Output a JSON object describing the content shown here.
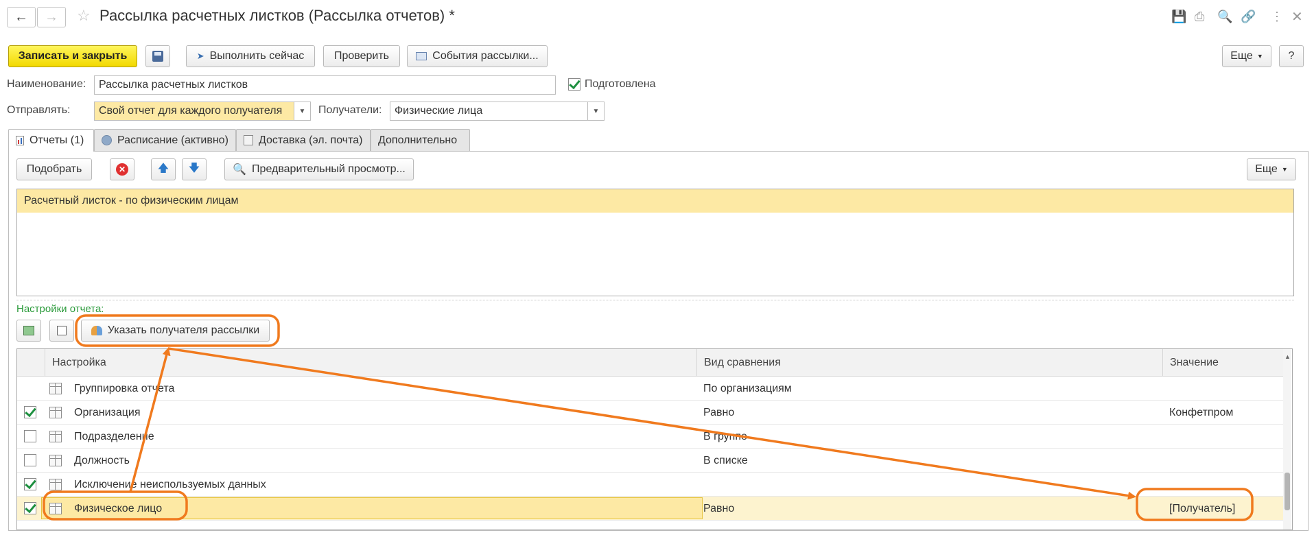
{
  "window": {
    "title": "Рассылка расчетных листков (Рассылка отчетов) *"
  },
  "toolbar": {
    "save_close": "Записать и закрыть",
    "run_now": "Выполнить сейчас",
    "check": "Проверить",
    "events": "События рассылки...",
    "more": "Еще",
    "help": "?"
  },
  "form": {
    "name_label": "Наименование:",
    "name_value": "Рассылка расчетных листков",
    "prepared_label": "Подготовлена",
    "prepared_checked": true,
    "send_label": "Отправлять:",
    "send_value": "Свой отчет для каждого получателя",
    "recipients_label": "Получатели:",
    "recipients_value": "Физические лица"
  },
  "tabs": [
    {
      "label": "Отчеты (1)",
      "active": true
    },
    {
      "label": "Расписание (активно)",
      "active": false
    },
    {
      "label": "Доставка (эл. почта)",
      "active": false
    },
    {
      "label": "Дополнительно",
      "active": false
    }
  ],
  "reports_toolbar": {
    "pick": "Подобрать",
    "preview": "Предварительный просмотр...",
    "more": "Еще"
  },
  "reports": [
    "Расчетный листок - по физическим лицам"
  ],
  "settings": {
    "section_label": "Настройки отчета:",
    "specify_recipient": "Указать получателя рассылки",
    "columns": {
      "setting": "Настройка",
      "comparison": "Вид сравнения",
      "value": "Значение"
    },
    "rows": [
      {
        "check": null,
        "name": "Группировка отчета",
        "comparison": "По организациям",
        "value": ""
      },
      {
        "check": true,
        "name": "Организация",
        "comparison": "Равно",
        "value": "Конфетпром"
      },
      {
        "check": false,
        "name": "Подразделение",
        "comparison": "В группе",
        "value": ""
      },
      {
        "check": false,
        "name": "Должность",
        "comparison": "В списке",
        "value": ""
      },
      {
        "check": true,
        "name": "Исключение неиспользуемых данных",
        "comparison": "",
        "value": ""
      },
      {
        "check": true,
        "name": "Физическое лицо",
        "comparison": "Равно",
        "value": "[Получатель]"
      }
    ]
  },
  "colors": {
    "primary_button": "#f2d900",
    "annotation": "#f07a1e",
    "selection": "#fde9a4",
    "check_green": "#1e9040"
  }
}
